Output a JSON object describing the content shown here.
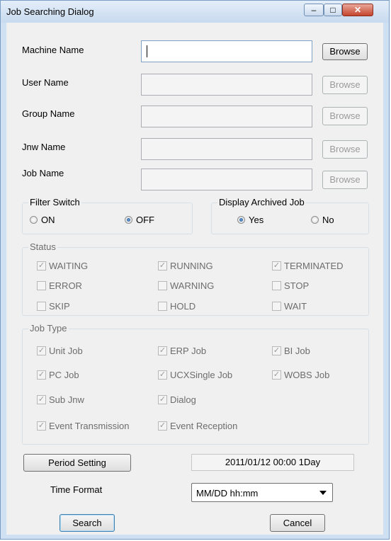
{
  "window": {
    "title": "Job Searching Dialog",
    "close_glyph": "✕",
    "maximize_glyph": "□",
    "minimize_glyph": "–"
  },
  "fields": {
    "machine": {
      "label": "Machine Name",
      "value": "",
      "button": "Browse",
      "enabled": true
    },
    "user": {
      "label": "User Name",
      "value": "",
      "button": "Browse",
      "enabled": false
    },
    "group": {
      "label": "Group Name",
      "value": "",
      "button": "Browse",
      "enabled": false
    },
    "jnw": {
      "label": "Jnw Name",
      "value": "",
      "button": "Browse",
      "enabled": false
    },
    "job": {
      "label": "Job Name",
      "value": "",
      "button": "Browse",
      "enabled": false
    }
  },
  "filter_switch": {
    "title": "Filter Switch",
    "options": [
      {
        "label": "ON",
        "selected": false
      },
      {
        "label": "OFF",
        "selected": true
      }
    ]
  },
  "display_archived": {
    "title": "Display Archived Job",
    "options": [
      {
        "label": "Yes",
        "selected": true
      },
      {
        "label": "No",
        "selected": false
      }
    ]
  },
  "status": {
    "title": "Status",
    "items": [
      {
        "label": "WAITING",
        "checked": true
      },
      {
        "label": "RUNNING",
        "checked": true
      },
      {
        "label": "TERMINATED",
        "checked": true
      },
      {
        "label": "ERROR",
        "checked": false
      },
      {
        "label": "WARNING",
        "checked": false
      },
      {
        "label": "STOP",
        "checked": false
      },
      {
        "label": "SKIP",
        "checked": false
      },
      {
        "label": "HOLD",
        "checked": false
      },
      {
        "label": "WAIT",
        "checked": false
      }
    ]
  },
  "job_type": {
    "title": "Job Type",
    "items": [
      {
        "label": "Unit Job",
        "checked": true
      },
      {
        "label": "ERP Job",
        "checked": true
      },
      {
        "label": "BI Job",
        "checked": true
      },
      {
        "label": "PC Job",
        "checked": true
      },
      {
        "label": "UCXSingle Job",
        "checked": true
      },
      {
        "label": "WOBS Job",
        "checked": true
      },
      {
        "label": "Sub Jnw",
        "checked": true
      },
      {
        "label": "Dialog",
        "checked": true
      },
      {
        "label": "Event Transmission",
        "checked": true
      },
      {
        "label": "Event Reception",
        "checked": true
      }
    ]
  },
  "period": {
    "button": "Period Setting",
    "value": "2011/01/12 00:00   1Day"
  },
  "time_format": {
    "label": "Time Format",
    "selected": "MM/DD hh:mm"
  },
  "actions": {
    "search": "Search",
    "cancel": "Cancel"
  },
  "check_glyph": "✓"
}
